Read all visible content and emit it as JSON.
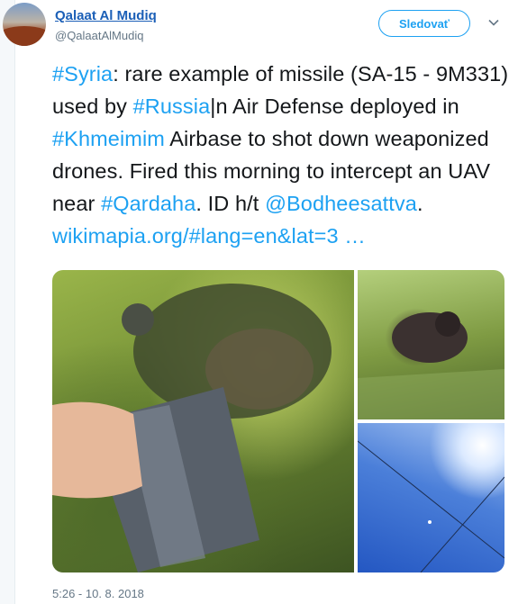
{
  "user": {
    "name": "Qalaat Al Mudiq",
    "handle": "@QalaatAlMudiq"
  },
  "follow_button": {
    "label": "Sledovať"
  },
  "menu": {
    "icon": "chevron-down-icon"
  },
  "tweet": {
    "segments": [
      {
        "text": "#Syria",
        "link": true
      },
      {
        "text": ": rare example of missile (SA-15 - 9M331) used by ",
        "link": false
      },
      {
        "text": "#Russia",
        "link": true
      },
      {
        "text": "|n Air Defense deployed in ",
        "link": false
      },
      {
        "text": "#Khmeimim",
        "link": true
      },
      {
        "text": " Airbase to shot down weaponized drones. Fired this morning to intercept an UAV near ",
        "link": false
      },
      {
        "text": "#Qardaha",
        "link": true
      },
      {
        "text": ". ID h/t ",
        "link": false
      },
      {
        "text": "@Bodheesattva",
        "link": true
      },
      {
        "text": ". ",
        "link": false
      },
      {
        "text": "wikimapia.org/#lang=en&lat=3 …",
        "link": true
      }
    ],
    "timestamp": "5:26 - 10. 8. 2018"
  },
  "media": {
    "photos": [
      {
        "alt": "missile-debris-in-grass"
      },
      {
        "alt": "missile-part-in-grass"
      },
      {
        "alt": "missile-trail-in-sky"
      }
    ]
  },
  "colors": {
    "link": "#1da1f2",
    "name": "#1b5fb7",
    "meta": "#657786"
  }
}
